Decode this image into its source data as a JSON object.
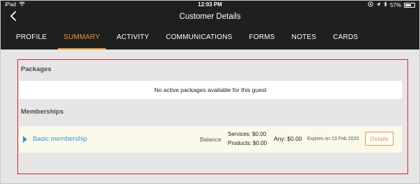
{
  "status_bar": {
    "device": "iPad",
    "time": "12:03 PM",
    "battery": "57%",
    "battery_level": 0.57
  },
  "header": {
    "back_icon": "chevron-left-icon",
    "title": "Customer Details"
  },
  "tabs": [
    {
      "label": "PROFILE",
      "active": false
    },
    {
      "label": "SUMMARY",
      "active": true
    },
    {
      "label": "ACTIVITY",
      "active": false
    },
    {
      "label": "COMMUNICATIONS",
      "active": false
    },
    {
      "label": "FORMS",
      "active": false
    },
    {
      "label": "NOTES",
      "active": false
    },
    {
      "label": "CARDS",
      "active": false
    }
  ],
  "packages": {
    "heading": "Packages",
    "empty_message": "No active packages available for this guest"
  },
  "memberships": {
    "heading": "Memberships",
    "items": [
      {
        "name": "Basic membership",
        "balance_label": "Balance",
        "services": "Services: $0.00",
        "products": "Products: $0.00",
        "any": "Any: $0.00",
        "expires": "Expires on 13 Feb 2020",
        "details_label": "Details"
      }
    ]
  },
  "colors": {
    "accent": "#f0952c",
    "link": "#2a9bd4",
    "highlight_border": "#e0202a",
    "header_bg": "#1f1f1f"
  }
}
